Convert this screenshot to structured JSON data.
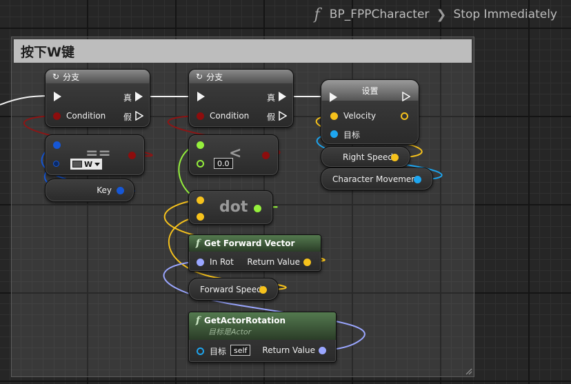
{
  "breadcrumb": {
    "function_icon": "f",
    "blueprint": "BP_FPPCharacter",
    "function": "Stop Immediately"
  },
  "comment": {
    "title": "按下W键"
  },
  "nodes": {
    "branch1": {
      "title": "分支",
      "condition": "Condition",
      "true_label": "真",
      "false_label": "假"
    },
    "branch2": {
      "title": "分支",
      "condition": "Condition",
      "true_label": "真",
      "false_label": "假"
    },
    "equal": {
      "op": "==",
      "key_value": "W"
    },
    "key_var": {
      "label": "Key"
    },
    "less": {
      "op": "<",
      "value": "0.0"
    },
    "dot": {
      "label": "dot"
    },
    "set": {
      "title": "设置",
      "velocity": "Velocity",
      "target": "目标"
    },
    "right_speed": {
      "label": "Right Speed"
    },
    "char_move": {
      "label": "Character Movement"
    },
    "forward_vec": {
      "fx": "f",
      "title": "Get Forward Vector",
      "in_rot": "In Rot",
      "return_value": "Return Value"
    },
    "forward_speed": {
      "label": "Forward Speed"
    },
    "actor_rot": {
      "fx": "f",
      "title": "GetActorRotation",
      "subtitle": "目标是Actor",
      "target": "目标",
      "self": "self",
      "return_value": "Return Value"
    }
  },
  "colors": {
    "exec": "#f5f5f5",
    "bool": "#8d0d0d",
    "struct_key": "#1657d6",
    "float": "#95f03c",
    "vector": "#f6c21c",
    "rotator": "#9aa6ff",
    "object": "#1ea6f0"
  }
}
